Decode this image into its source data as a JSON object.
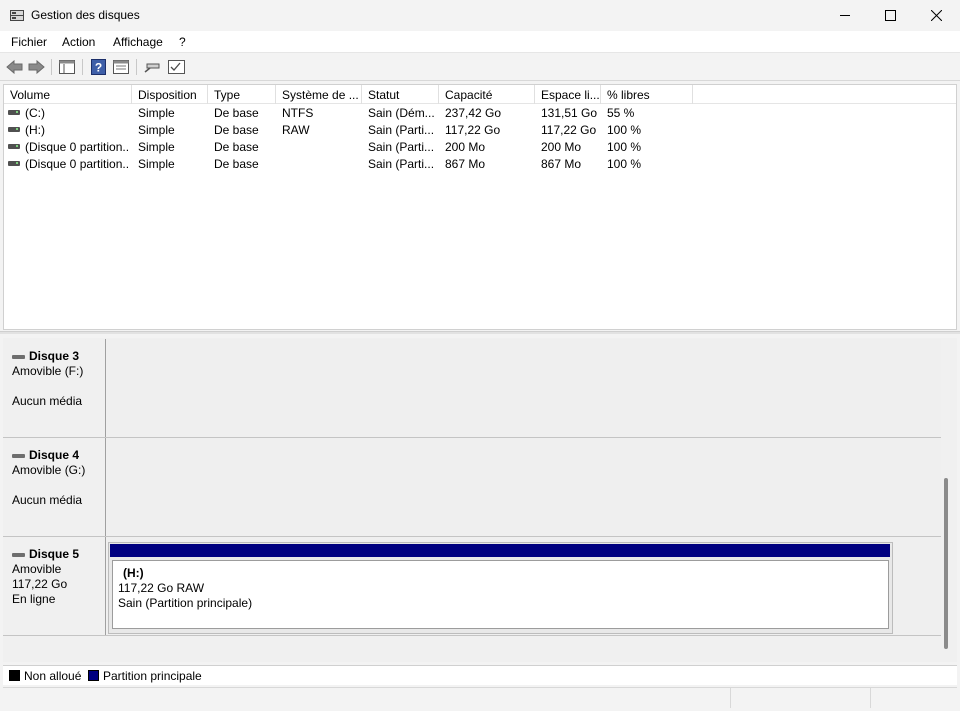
{
  "window": {
    "title": "Gestion des disques"
  },
  "menu": [
    "Fichier",
    "Action",
    "Affichage",
    "?"
  ],
  "toolbar": {
    "buttons": [
      "back-icon",
      "forward-icon",
      "console-tree-icon",
      "help-icon",
      "properties-icon",
      "connect-icon",
      "settings-icon"
    ]
  },
  "volume_list": {
    "columns": [
      "Volume",
      "Disposition",
      "Type",
      "Système de ...",
      "Statut",
      "Capacité",
      "Espace li...",
      "% libres"
    ],
    "rows": [
      [
        "(C:)",
        "Simple",
        "De base",
        "NTFS",
        "Sain (Dém...",
        "237,42 Go",
        "131,51 Go",
        "55 %"
      ],
      [
        "(H:)",
        "Simple",
        "De base",
        "RAW",
        "Sain (Parti...",
        "117,22 Go",
        "117,22 Go",
        "100 %"
      ],
      [
        "(Disque 0 partition...",
        "Simple",
        "De base",
        "",
        "Sain (Parti...",
        "200 Mo",
        "200 Mo",
        "100 %"
      ],
      [
        "(Disque 0 partition...",
        "Simple",
        "De base",
        "",
        "Sain (Parti...",
        "867 Mo",
        "867 Mo",
        "100 %"
      ]
    ]
  },
  "disks": [
    {
      "name": "Disque 3",
      "line1": "Amovible (F:)",
      "line2": "",
      "line3": "Aucun média"
    },
    {
      "name": "Disque 4",
      "line1": "Amovible (G:)",
      "line2": "",
      "line3": "Aucun média"
    },
    {
      "name": "Disque 5",
      "line1": "Amovible",
      "line2": "117,22 Go",
      "line3": "En ligne",
      "partition": {
        "label": "(H:)",
        "size": "117,22 Go RAW",
        "status": "Sain (Partition principale)"
      }
    }
  ],
  "legend": {
    "items": [
      {
        "label": "Non alloué",
        "color": "#000000"
      },
      {
        "label": "Partition principale",
        "color": "#000080"
      }
    ]
  }
}
